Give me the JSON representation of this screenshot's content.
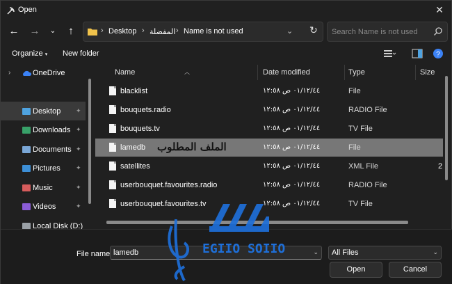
{
  "window": {
    "title": "Open"
  },
  "address": {
    "crumbs": [
      "Desktop",
      "المفضلة",
      "Name is not used"
    ]
  },
  "search": {
    "placeholder": "Search Name is not used"
  },
  "toolbar": {
    "organize": "Organize",
    "new_folder": "New folder"
  },
  "sidebar": {
    "onedrive": "OneDrive",
    "items": [
      {
        "label": "Desktop",
        "icon": "desktop-icon",
        "color": "#4fa3e0"
      },
      {
        "label": "Downloads",
        "icon": "downloads-icon",
        "color": "#38a169"
      },
      {
        "label": "Documents",
        "icon": "documents-icon",
        "color": "#7aa7d6"
      },
      {
        "label": "Pictures",
        "icon": "pictures-icon",
        "color": "#3d8fd6"
      },
      {
        "label": "Music",
        "icon": "music-icon",
        "color": "#d65c5c"
      },
      {
        "label": "Videos",
        "icon": "videos-icon",
        "color": "#8a5cd6"
      },
      {
        "label": "Local Disk (D:)",
        "icon": "drive-icon",
        "color": "#9aa0a6"
      }
    ]
  },
  "columns": {
    "name": "Name",
    "date": "Date modified",
    "type": "Type",
    "size": "Size"
  },
  "files": [
    {
      "name": "blacklist",
      "date": "٠١/١٢/٤٤ ص ١٢:٥٨",
      "type": "File",
      "size": ""
    },
    {
      "name": "bouquets.radio",
      "date": "٠١/١٢/٤٤ ص ١٢:٥٨",
      "type": "RADIO File",
      "size": ""
    },
    {
      "name": "bouquets.tv",
      "date": "٠١/١٢/٤٤ ص ١٢:٥٨",
      "type": "TV File",
      "size": ""
    },
    {
      "name": "lamedb",
      "date": "٠١/١٢/٤٤ ص ١٢:٥٨",
      "type": "File",
      "size": ""
    },
    {
      "name": "satellites",
      "date": "٠١/١٢/٤٤ ص ١٢:٥٨",
      "type": "XML File",
      "size": "2"
    },
    {
      "name": "userbouquet.favourites.radio",
      "date": "٠١/١٢/٤٤ ص ١٢:٥٨",
      "type": "RADIO File",
      "size": ""
    },
    {
      "name": "userbouquet.favourites.tv",
      "date": "٠١/١٢/٤٤ ص ١٢:٥٨",
      "type": "TV File",
      "size": ""
    }
  ],
  "annotation": "الملف المطلوب",
  "bottom": {
    "file_name_label": "File name:",
    "file_name_value": "lamedb",
    "filter": "All Files",
    "open": "Open",
    "cancel": "Cancel"
  },
  "watermark": {
    "text": "EGIIO SOIIO"
  },
  "colors": {
    "selection": "#777777",
    "accent_help": "#3b82f6",
    "background": "#202020"
  }
}
